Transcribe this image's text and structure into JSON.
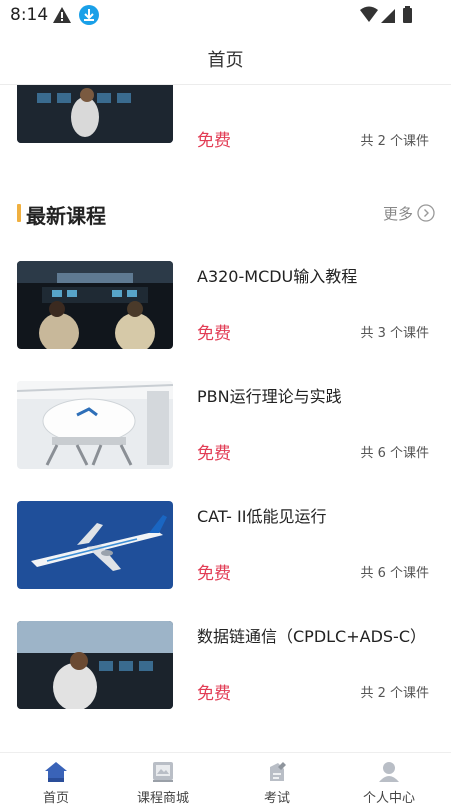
{
  "status_bar": {
    "time": "8:14"
  },
  "header": {
    "title": "首页"
  },
  "top_partial_card": {
    "price": "免费",
    "lesson_count": "共 2 个课件"
  },
  "latest_section": {
    "title": "最新课程",
    "more_label": "更多",
    "courses": [
      {
        "title": "A320-MCDU输入教程",
        "price": "免费",
        "lesson_count": "共 3 个课件"
      },
      {
        "title": "PBN运行理论与实践",
        "price": "免费",
        "lesson_count": "共 6 个课件"
      },
      {
        "title": "CAT- II低能见运行",
        "price": "免费",
        "lesson_count": "共 6 个课件"
      },
      {
        "title": "数据链通信（CPDLC+ADS-C）",
        "price": "免费",
        "lesson_count": "共 2 个课件"
      }
    ]
  },
  "tab_bar": {
    "active_color": "#3a63b8",
    "tabs": [
      {
        "label": "首页",
        "icon": "home-icon"
      },
      {
        "label": "课程商城",
        "icon": "book-icon"
      },
      {
        "label": "考试",
        "icon": "exam-icon"
      },
      {
        "label": "个人中心",
        "icon": "user-icon"
      }
    ]
  }
}
